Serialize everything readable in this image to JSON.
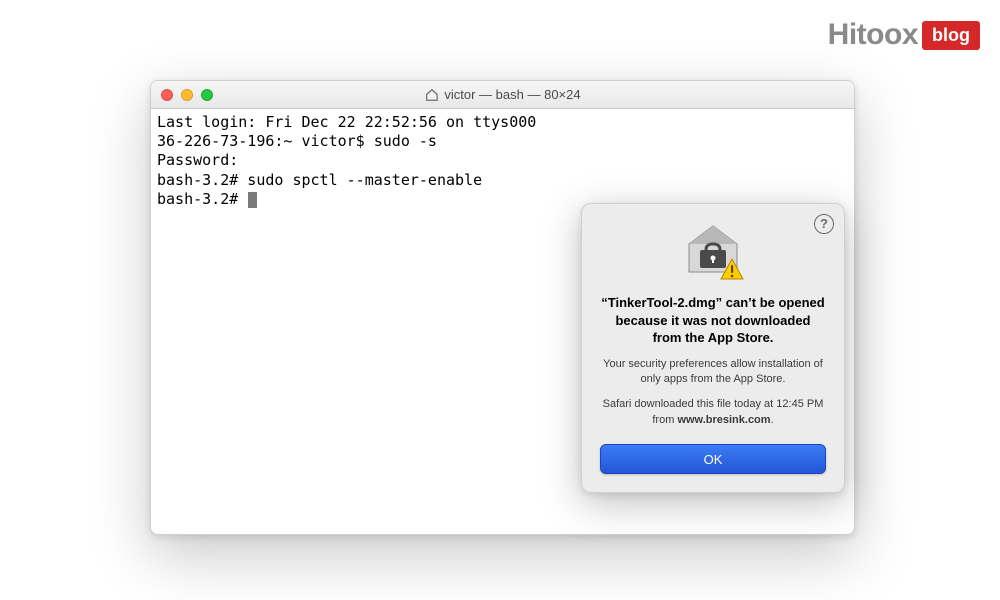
{
  "watermark": {
    "brand": "Hitoox",
    "badge": "blog"
  },
  "terminal": {
    "title": "victor — bash — 80×24",
    "lines": {
      "l1": "Last login: Fri Dec 22 22:52:56 on ttys000",
      "l2": "36-226-73-196:~ victor$ sudo -s",
      "l3": "Password:",
      "l4": "bash-3.2# sudo spctl --master-enable",
      "l5": "bash-3.2# "
    }
  },
  "alert": {
    "help": "?",
    "title": "“TinkerTool-2.dmg” can’t be opened because it was not downloaded from the App Store.",
    "body": "Your security preferences allow installation of only apps from the App Store.",
    "source_prefix": "Safari downloaded this file today at 12:45 PM from ",
    "source_host": "www.bresink.com",
    "source_suffix": ".",
    "ok": "OK"
  }
}
